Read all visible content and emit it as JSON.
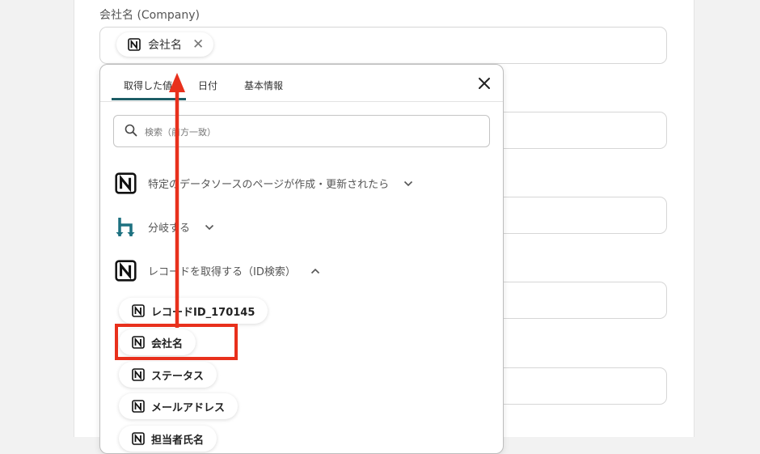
{
  "form": {
    "company_label": "会社名 (Company)",
    "selected_chip": "会社名"
  },
  "popup": {
    "tabs": [
      "取得した値",
      "日付",
      "基本情報"
    ],
    "search_placeholder": "検索（前方一致）",
    "sections": [
      {
        "label": "特定のデータソースのページが作成・更新されたら",
        "icon": "notion-icon",
        "expanded": false
      },
      {
        "label": "分岐する",
        "icon": "branch-icon",
        "expanded": false
      },
      {
        "label": "レコードを取得する（ID検索）",
        "icon": "notion-icon",
        "expanded": true
      }
    ],
    "items": [
      {
        "label": "レコードID_170145"
      },
      {
        "label": "会社名"
      },
      {
        "label": "ステータス"
      },
      {
        "label": "メールアドレス"
      },
      {
        "label": "担当者氏名"
      }
    ]
  },
  "annotation": {
    "highlight_color": "#e8301c",
    "tab_accent": "#1d5d66",
    "branch_icon_color": "#1d7180"
  }
}
